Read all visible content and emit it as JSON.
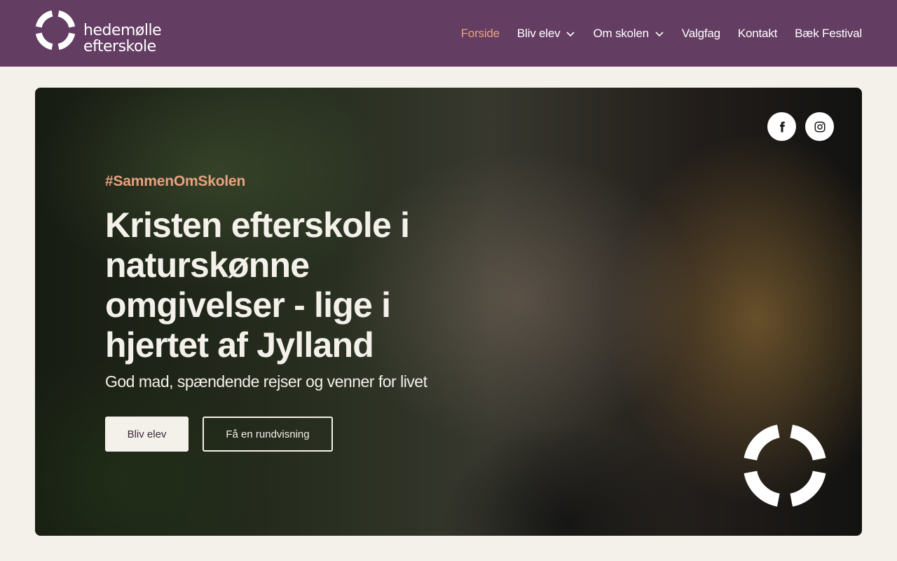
{
  "header": {
    "logo": {
      "line1": "hedemølle",
      "line2": "efterskole",
      "icon": "ring-logo-icon"
    },
    "nav": [
      {
        "label": "Forside",
        "active": true,
        "has_dropdown": false
      },
      {
        "label": "Bliv elev",
        "active": false,
        "has_dropdown": true
      },
      {
        "label": "Om skolen",
        "active": false,
        "has_dropdown": true
      },
      {
        "label": "Valgfag",
        "active": false,
        "has_dropdown": false
      },
      {
        "label": "Kontakt",
        "active": false,
        "has_dropdown": false
      },
      {
        "label": "Bæk Festival",
        "active": false,
        "has_dropdown": false
      }
    ]
  },
  "hero": {
    "hashtag_symbol": "#",
    "hashtag": "SammenOmSkolen",
    "headline": "Kristen efterskole i naturskønne omgivelser - lige i hjertet af Jylland",
    "subline": "God mad, spændende rejser og venner for livet",
    "primary_button": "Bliv elev",
    "secondary_button": "Få en rundvisning",
    "social": [
      "facebook-icon",
      "instagram-icon"
    ]
  },
  "colors": {
    "header_bg": "#643d63",
    "accent": "#e8a27f",
    "page_bg": "#f4f1ea"
  }
}
